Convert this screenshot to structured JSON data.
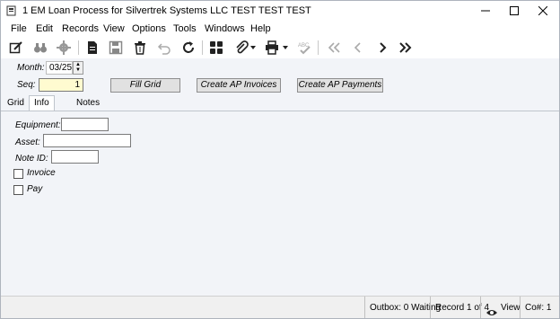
{
  "window": {
    "title": "1 EM Loan Process for Silvertrek Systems LLC TEST TEST TEST",
    "controls": [
      "minimize-icon",
      "maximize-icon",
      "close-icon"
    ]
  },
  "menu": [
    "File",
    "Edit",
    "Records",
    "View",
    "Options",
    "Tools",
    "Windows",
    "Help"
  ],
  "toolbar_icons": [
    "edit-icon",
    "binoculars-icon",
    "gear-icon",
    "new-record-icon",
    "save-icon",
    "delete-icon",
    "undo-icon",
    "refresh-icon",
    "grid-icon",
    "attach-icon",
    "print-icon",
    "spellcheck-icon",
    "first-record-icon",
    "previous-record-icon",
    "next-record-icon",
    "last-record-icon"
  ],
  "form": {
    "month_label": "Month:",
    "month_value": "03/25",
    "seq_label": "Seq:",
    "seq_value": "1",
    "buttons": {
      "fill_grid": "Fill Grid",
      "create_ap_invoices": "Create AP Invoices",
      "create_ap_payments": "Create AP Payments"
    }
  },
  "tabs": [
    "Grid",
    "Info",
    "Notes"
  ],
  "info": {
    "equipment_label": "Equipment:",
    "equipment_value": "",
    "asset_label": "Asset:",
    "asset_value": "",
    "note_id_label": "Note ID:",
    "note_id_value": "",
    "invoice_label": "Invoice",
    "pay_label": "Pay"
  },
  "status": {
    "outbox": "Outbox: 0 Waiting",
    "record": "Record 1 of 4",
    "view": "View",
    "co": "Co#: 1"
  },
  "colors": {
    "highlight_input": "#fffbd0",
    "panel_bg": "#f2f4f8"
  }
}
